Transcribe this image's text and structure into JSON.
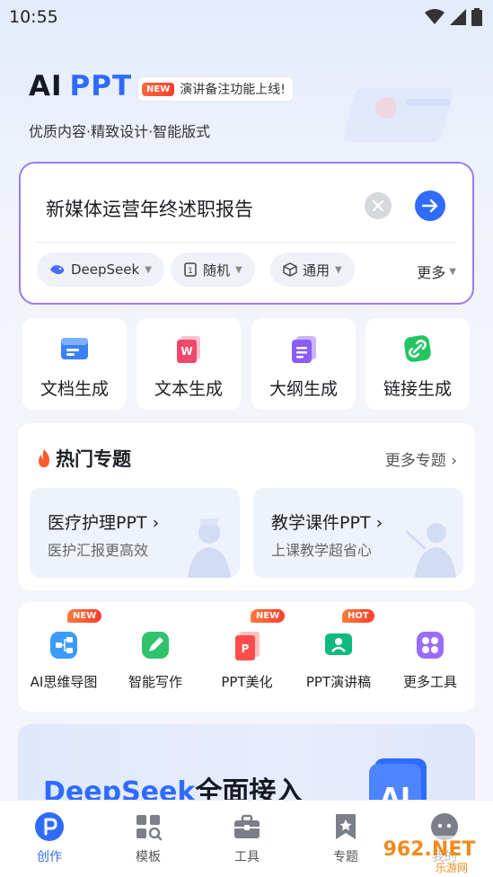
{
  "status": {
    "time": "10:55"
  },
  "hero": {
    "title_ai": "AI",
    "title_ppt": "PPT",
    "badge_tag": "NEW",
    "badge_text": "演讲备注功能上线!",
    "subtitle": "优质内容·精致设计·智能版式"
  },
  "input": {
    "value": "新媒体运营年终述职报告",
    "chips": [
      {
        "label": "DeepSeek",
        "icon": "deepseek-logo-icon"
      },
      {
        "label": "随机",
        "icon": "page-count-icon"
      },
      {
        "label": "通用",
        "icon": "cube-icon"
      }
    ],
    "more_label": "更多"
  },
  "generate": [
    {
      "label": "文档生成",
      "icon": "document-icon"
    },
    {
      "label": "文本生成",
      "icon": "word-text-icon"
    },
    {
      "label": "大纲生成",
      "icon": "outline-icon"
    },
    {
      "label": "链接生成",
      "icon": "link-icon"
    }
  ],
  "hot": {
    "title": "热门专题",
    "more": "更多专题",
    "topics": [
      {
        "title": "医疗护理PPT",
        "subtitle": "医护汇报更高效"
      },
      {
        "title": "教学课件PPT",
        "subtitle": "上课教学超省心"
      }
    ]
  },
  "tools": [
    {
      "label": "AI思维导图",
      "badge": "NEW",
      "icon": "mindmap-icon"
    },
    {
      "label": "智能写作",
      "badge": "",
      "icon": "writing-icon"
    },
    {
      "label": "PPT美化",
      "badge": "NEW",
      "icon": "ppt-beautify-icon"
    },
    {
      "label": "PPT演讲稿",
      "badge": "HOT",
      "icon": "speech-icon"
    },
    {
      "label": "更多工具",
      "badge": "",
      "icon": "more-tools-icon"
    }
  ],
  "banner": {
    "highlight": "DeepSeek",
    "rest": "全面接入",
    "ai_label": "AI"
  },
  "tabs": [
    {
      "label": "创作",
      "active": true,
      "icon": "create-icon"
    },
    {
      "label": "模板",
      "active": false,
      "icon": "template-icon"
    },
    {
      "label": "工具",
      "active": false,
      "icon": "toolbox-icon"
    },
    {
      "label": "专题",
      "active": false,
      "icon": "topic-icon"
    },
    {
      "label": "我的",
      "active": false,
      "icon": "profile-icon"
    }
  ],
  "watermark": {
    "brand": "962.NET",
    "sub": "乐游网"
  },
  "colors": {
    "accent": "#2f6bff",
    "border_purple": "#9c7bf0",
    "hot_badge": "#ff3d2e"
  }
}
